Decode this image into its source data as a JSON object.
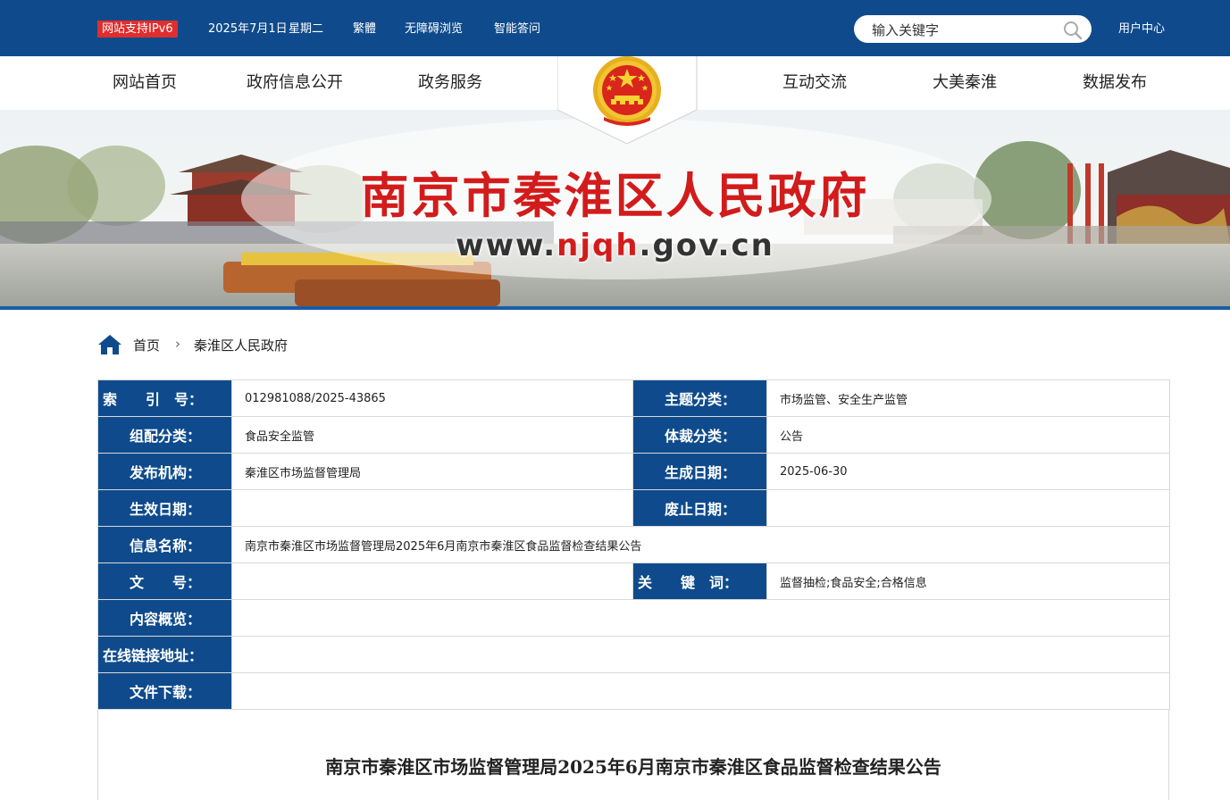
{
  "topbar": {
    "ipv6_badge": "网站支持IPv6",
    "date": "2025年7月1日",
    "weekday": "星期二",
    "traditional": "繁體",
    "accessibility": "无障碍浏览",
    "smart_qa": "智能答问",
    "search_placeholder": "输入关键字",
    "user_center": "用户中心"
  },
  "nav": {
    "items": [
      "网站首页",
      "政府信息公开",
      "政务服务",
      "互动交流",
      "大美秦淮",
      "数据发布"
    ]
  },
  "banner": {
    "title": "南京市秦淮区人民政府",
    "url_prefix": "www.",
    "url_highlight": "njqh",
    "url_suffix": ".gov.cn"
  },
  "breadcrumb": {
    "home": "首页",
    "separator": "›",
    "current": "秦淮区人民政府"
  },
  "info": {
    "index_label": "索　　引　号：",
    "index_value": "012981088/2025-43865",
    "topic_label": "主题分类：",
    "topic_value": "市场监管、安全生产监管",
    "org_cat_label": "组配分类：",
    "org_cat_value": "食品安全监管",
    "genre_label": "体裁分类：",
    "genre_value": "公告",
    "publisher_label": "发布机构：",
    "publisher_value": "秦淮区市场监督管理局",
    "created_label": "生成日期：",
    "created_value": "2025-06-30",
    "effective_label": "生效日期：",
    "effective_value": "",
    "expire_label": "废止日期：",
    "expire_value": "",
    "name_label": "信息名称：",
    "name_value": "南京市秦淮区市场监督管理局2025年6月南京市秦淮区食品监督检查结果公告",
    "docno_label": "文　　号：",
    "docno_value": "",
    "keywords_label": "关　　键　词：",
    "keywords_value": "监督抽检;食品安全;合格信息",
    "summary_label": "内容概览：",
    "summary_value": "",
    "link_label": "在线链接地址：",
    "link_value": "",
    "download_label": "文件下载：",
    "download_value": ""
  },
  "article": {
    "title": "南京市秦淮区市场监督管理局2025年6月南京市秦淮区食品监督检查结果公告"
  },
  "colors": {
    "primary_blue": "#0f4b8c",
    "title_red": "#d21c1c",
    "ipv6_red": "#e02d2d"
  }
}
